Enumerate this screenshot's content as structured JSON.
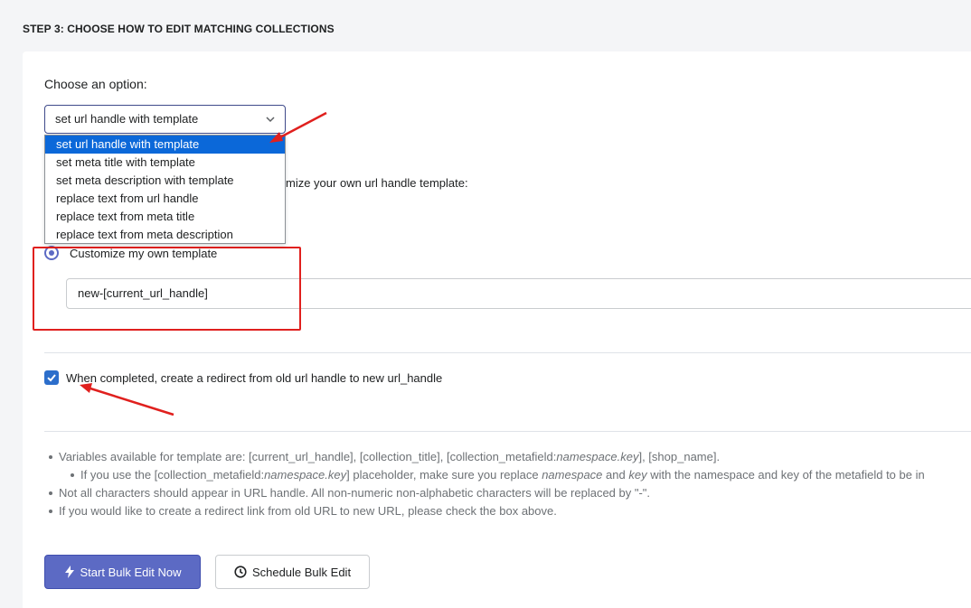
{
  "step_title": "STEP 3: CHOOSE HOW TO EDIT MATCHING COLLECTIONS",
  "choose_label": "Choose an option:",
  "select": {
    "value": "set url handle with template",
    "icon": "chevron-down-icon",
    "options": [
      "set url handle with template",
      "set meta title with template",
      "set meta description with template",
      "replace text from url handle",
      "replace text from meta title",
      "replace text from meta description"
    ]
  },
  "partial_text": "mize your own url handle template:",
  "radio_label": "Customize my own template",
  "template_value": "new-[current_url_handle]",
  "checkbox_label": "When completed, create a redirect from old url handle to new url_handle",
  "notes": {
    "n1_a": "Variables available for template are: [current_url_handle], [collection_title], [collection_metafield:",
    "n1_b": "namespace.key",
    "n1_c": "], [shop_name].",
    "n1s_a": "If you use the [collection_metafield:",
    "n1s_b": "namespace.key",
    "n1s_c": "] placeholder, make sure you replace ",
    "n1s_d": "namespace",
    "n1s_e": " and ",
    "n1s_f": "key",
    "n1s_g": " with the namespace and key of the metafield to be in",
    "n2": "Not all characters should appear in URL handle. All non-numeric non-alphabetic characters will be replaced by \"-\".",
    "n3": "If you would like to create a redirect link from old URL to new URL, please check the box above."
  },
  "buttons": {
    "start": "Start Bulk Edit Now",
    "start_icon": "bolt-icon",
    "schedule": "Schedule Bulk Edit",
    "schedule_icon": "clock-icon"
  },
  "colors": {
    "primary": "#5c6ac4",
    "selected_option": "#0b68d9",
    "annotation_red": "#e0201e",
    "checkbox": "#2c6ecb"
  }
}
